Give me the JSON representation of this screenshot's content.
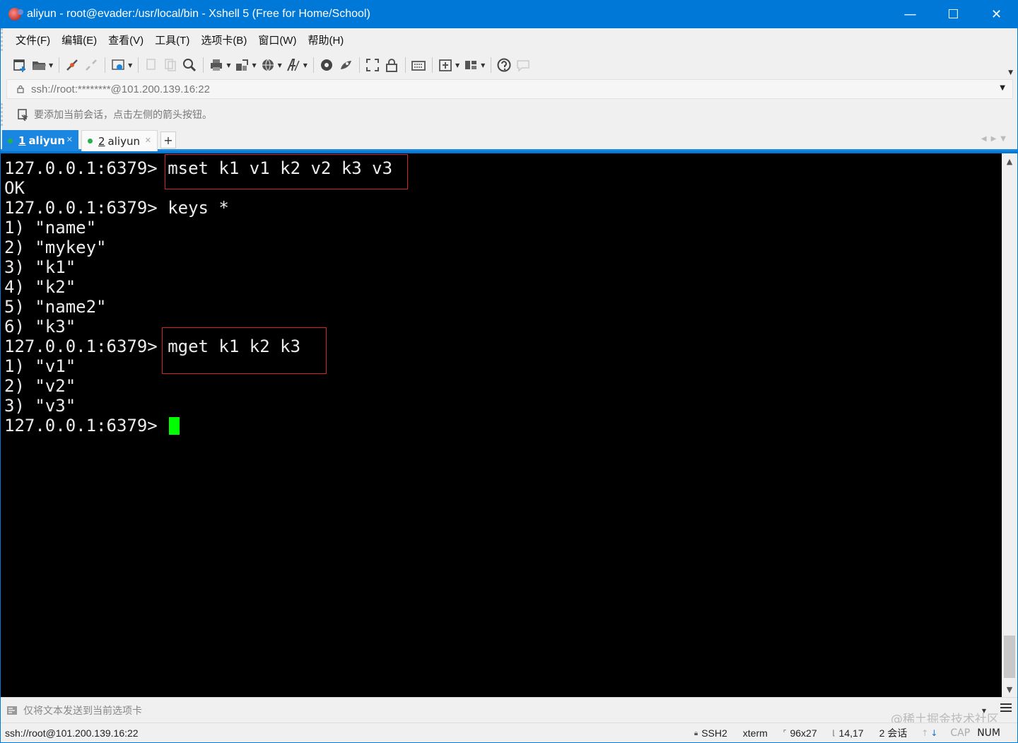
{
  "window": {
    "title": "aliyun - root@evader:/usr/local/bin - Xshell 5 (Free for Home/School)",
    "controls": [
      "—",
      "☐",
      "✕"
    ]
  },
  "menu": [
    "文件(F)",
    "编辑(E)",
    "查看(V)",
    "工具(T)",
    "选项卡(B)",
    "窗口(W)",
    "帮助(H)"
  ],
  "toolbar": {
    "icons": [
      "new-session-icon",
      "open-folder-icon",
      "connect-icon",
      "disconnect-icon",
      "properties-icon",
      "copy-icon",
      "paste-icon",
      "find-icon",
      "print-icon",
      "transfer-icon",
      "globe-icon",
      "font-icon",
      "xftp-icon",
      "xmanager-icon",
      "fullscreen-icon",
      "lock-icon",
      "keyboard-icon",
      "add-tab-icon",
      "layout-icon",
      "help-icon",
      "chat-icon"
    ]
  },
  "address": {
    "text": "ssh://root:********@101.200.139.16:22"
  },
  "hint": {
    "text": "要添加当前会话，点击左侧的箭头按钮。"
  },
  "tabs": [
    {
      "num": "1",
      "label": "aliyun",
      "active": true
    },
    {
      "num": "2",
      "label": "aliyun",
      "active": false
    }
  ],
  "terminal": {
    "lines": [
      "127.0.0.1:6379> mset k1 v1 k2 v2 k3 v3",
      "OK",
      "127.0.0.1:6379> keys *",
      "1) \"name\"",
      "2) \"mykey\"",
      "3) \"k1\"",
      "4) \"k2\"",
      "5) \"name2\"",
      "6) \"k3\"",
      "127.0.0.1:6379> mget k1 k2 k3",
      "1) \"v1\"",
      "2) \"v2\"",
      "3) \"v3\"",
      "127.0.0.1:6379> "
    ],
    "cursor_color": "#00ff00",
    "highlight_color": "#d42525"
  },
  "compose": {
    "text": "仅将文本发送到当前选项卡",
    "watermark": "@稀土掘金技术社区"
  },
  "status": {
    "connection": "ssh://root@101.200.139.16:22",
    "protocol": "SSH2",
    "terminal_type": "xterm",
    "size": "96x27",
    "cursor_pos": "14,17",
    "sessions": "2 会话",
    "cap": "CAP",
    "num": "NUM"
  }
}
